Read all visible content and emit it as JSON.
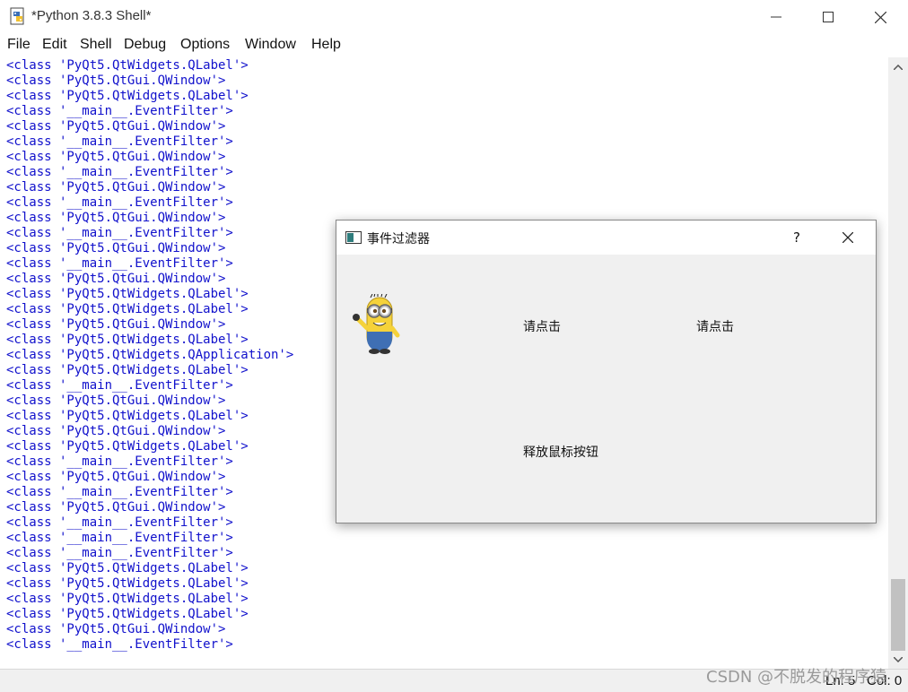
{
  "window": {
    "title": "*Python 3.8.3 Shell*",
    "controls": [
      "minimize",
      "maximize",
      "close"
    ]
  },
  "menu": [
    "File",
    "Edit",
    "Shell",
    "Debug",
    "Options",
    "Window",
    "Help"
  ],
  "shell_lines": [
    "<class 'PyQt5.QtWidgets.QLabel'>",
    "<class 'PyQt5.QtGui.QWindow'>",
    "<class 'PyQt5.QtWidgets.QLabel'>",
    "<class '__main__.EventFilter'>",
    "<class 'PyQt5.QtGui.QWindow'>",
    "<class '__main__.EventFilter'>",
    "<class 'PyQt5.QtGui.QWindow'>",
    "<class '__main__.EventFilter'>",
    "<class 'PyQt5.QtGui.QWindow'>",
    "<class '__main__.EventFilter'>",
    "<class 'PyQt5.QtGui.QWindow'>",
    "<class '__main__.EventFilter'>",
    "<class 'PyQt5.QtGui.QWindow'>",
    "<class '__main__.EventFilter'>",
    "<class 'PyQt5.QtGui.QWindow'>",
    "<class 'PyQt5.QtWidgets.QLabel'>",
    "<class 'PyQt5.QtWidgets.QLabel'>",
    "<class 'PyQt5.QtGui.QWindow'>",
    "<class 'PyQt5.QtWidgets.QLabel'>",
    "<class 'PyQt5.QtWidgets.QApplication'>",
    "<class 'PyQt5.QtWidgets.QLabel'>",
    "<class '__main__.EventFilter'>",
    "<class 'PyQt5.QtGui.QWindow'>",
    "<class 'PyQt5.QtWidgets.QLabel'>",
    "<class 'PyQt5.QtGui.QWindow'>",
    "<class 'PyQt5.QtWidgets.QLabel'>",
    "<class '__main__.EventFilter'>",
    "<class 'PyQt5.QtGui.QWindow'>",
    "<class '__main__.EventFilter'>",
    "<class 'PyQt5.QtGui.QWindow'>",
    "<class '__main__.EventFilter'>",
    "<class '__main__.EventFilter'>",
    "<class '__main__.EventFilter'>",
    "<class 'PyQt5.QtWidgets.QLabel'>",
    "<class 'PyQt5.QtWidgets.QLabel'>",
    "<class 'PyQt5.QtWidgets.QLabel'>",
    "<class 'PyQt5.QtWidgets.QLabel'>",
    "<class 'PyQt5.QtGui.QWindow'>",
    "<class '__main__.EventFilter'>"
  ],
  "status": {
    "line": "Ln: 5",
    "col": "Col: 0"
  },
  "watermark": "CSDN @不脱发的程序猿",
  "dialog": {
    "title": "事件过滤器",
    "help": "?",
    "label1": "请点击",
    "label2": "请点击",
    "label3": "释放鼠标按钮",
    "image": "minion-icon"
  },
  "colors": {
    "shell_text": "#1111cc",
    "dialog_bg": "#f0f0f0"
  }
}
